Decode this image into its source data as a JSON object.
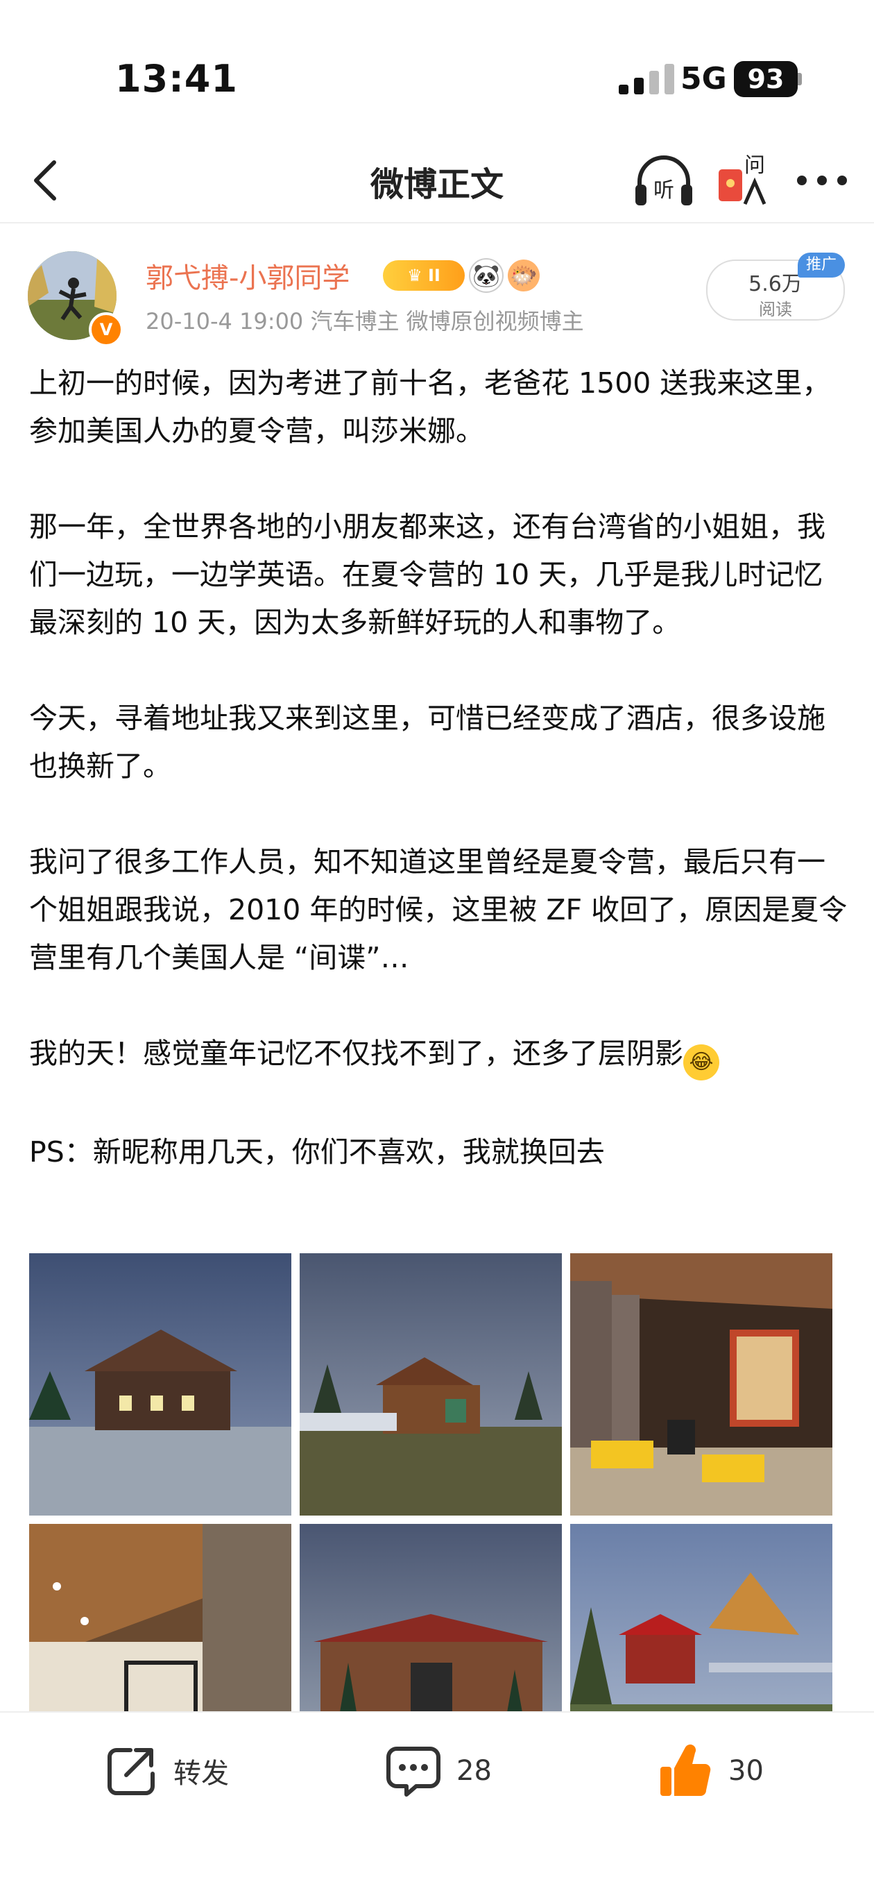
{
  "status_bar": {
    "time": "13:41",
    "network": "5G",
    "battery": "93"
  },
  "nav": {
    "title": "微博正文",
    "back_icon": "chevron-left-icon",
    "listen_label": "听",
    "ask_label": "问"
  },
  "author": {
    "name": "郭弋搏-小郭同学",
    "level_badge": "II",
    "verified": "V",
    "meta": "20-10-4 19:00  汽车博主 微博原创视频博主",
    "reads": "5.6万",
    "reads_label": "阅读",
    "ad_tag": "推广"
  },
  "post": {
    "paragraphs": [
      "上初一的时候，因为考进了前十名，老爸花 1500 送我来这里，参加美国人办的夏令营，叫莎米娜。",
      "那一年，全世界各地的小朋友都来这，还有台湾省的小姐姐，我们一边玩，一边学英语。在夏令营的 10 天，几乎是我儿时记忆最深刻的 10 天，因为太多新鲜好玩的人和事物了。",
      "今天，寻着地址我又来到这里，可惜已经变成了酒店，很多设施也换新了。",
      "我问了很多工作人员，知不知道这里曾经是夏令营，最后只有一个姐姐跟我说，2010 年的时候，这里被 ZF 收回了，原因是夏令营里有几个美国人是 “间谍”…",
      "我的天！感觉童年记忆不仅找不到了，还多了层阴影",
      "PS：新昵称用几天，你们不喜欢，我就换回去"
    ]
  },
  "actions": {
    "repost": "转发",
    "comments": "28",
    "likes": "30"
  },
  "colors": {
    "author": "#eb7350",
    "accent": "#ff8200",
    "meta": "#999999",
    "ad": "#4a90e2"
  }
}
